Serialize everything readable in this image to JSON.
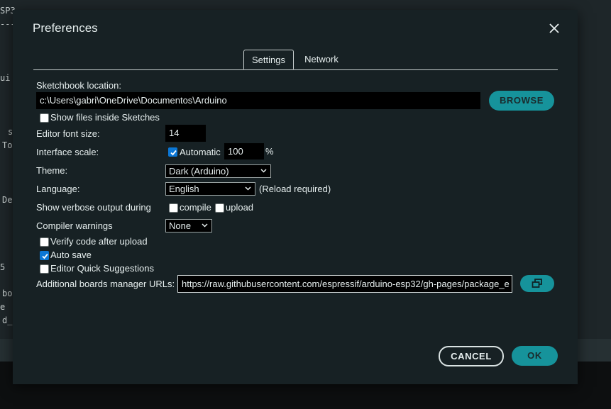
{
  "background": {
    "fragments": [
      "SP3",
      "---",
      "ui",
      "s",
      "To",
      "De",
      "5",
      "bo",
      "e",
      "d_"
    ]
  },
  "dialog": {
    "title": "Preferences",
    "close_icon": "close-icon"
  },
  "tabs": [
    {
      "label": "Settings",
      "selected": true
    },
    {
      "label": "Network",
      "selected": false
    }
  ],
  "settings": {
    "sketchbook_label": "Sketchbook location:",
    "sketchbook_path": "c:\\Users\\gabri\\OneDrive\\Documentos\\Arduino",
    "browse_label": "BROWSE",
    "show_files_label": "Show files inside Sketches",
    "show_files_checked": false,
    "font_size_label": "Editor font size:",
    "font_size_value": "14",
    "scale_label": "Interface scale:",
    "scale_auto_label": "Automatic",
    "scale_auto_checked": true,
    "scale_value": "100",
    "scale_unit": "%",
    "theme_label": "Theme:",
    "theme_value": "Dark (Arduino)",
    "language_label": "Language:",
    "language_value": "English",
    "language_note": "(Reload required)",
    "verbose_label": "Show verbose output during",
    "verbose_compile_label": "compile",
    "verbose_compile_checked": false,
    "verbose_upload_label": "upload",
    "verbose_upload_checked": false,
    "warnings_label": "Compiler warnings",
    "warnings_value": "None",
    "verify_label": "Verify code after upload",
    "verify_checked": false,
    "autosave_label": "Auto save",
    "autosave_checked": true,
    "quick_suggestions_label": "Editor Quick Suggestions",
    "quick_suggestions_checked": false,
    "urls_label": "Additional boards manager URLs:",
    "urls_value": "https://raw.githubusercontent.com/espressif/arduino-esp32/gh-pages/package_e",
    "urls_button_icon": "open-window-icon"
  },
  "footer": {
    "cancel_label": "CANCEL",
    "ok_label": "OK"
  },
  "colors": {
    "accent": "#16939b",
    "dialog_bg": "#172124",
    "checkbox_checked": "#0b77d6"
  }
}
